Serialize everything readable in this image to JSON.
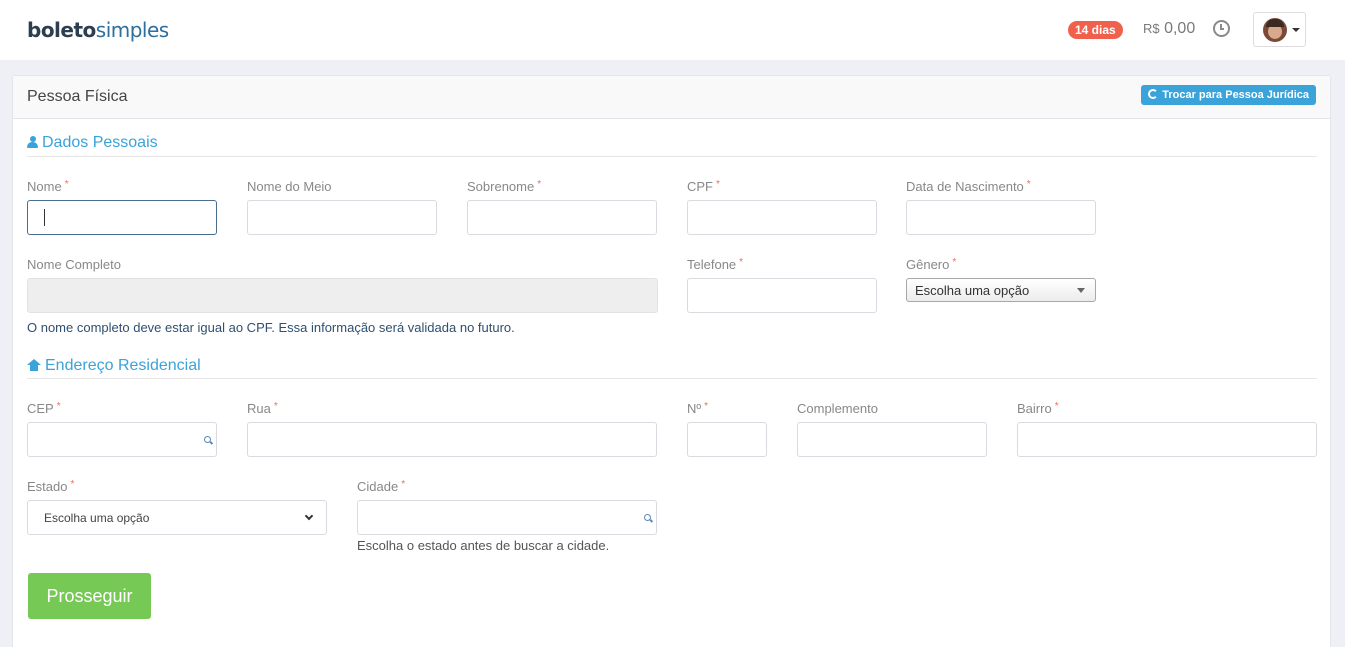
{
  "brand": {
    "part1": "boleto",
    "part2": "simples"
  },
  "header": {
    "trial_badge": "14 dias",
    "balance_currency": "R$",
    "balance_value": "0,00"
  },
  "panel": {
    "title": "Pessoa Física",
    "switch_button": "Trocar para Pessoa Jurídica"
  },
  "sections": {
    "personal": "Dados Pessoais",
    "address": "Endereço Residencial"
  },
  "fields": {
    "nome": "Nome",
    "nome_do_meio": "Nome do Meio",
    "sobrenome": "Sobrenome",
    "cpf": "CPF",
    "data_nascimento": "Data de Nascimento",
    "nome_completo": "Nome Completo",
    "telefone": "Telefone",
    "genero": "Gênero",
    "cep": "CEP",
    "rua": "Rua",
    "numero": "Nº",
    "complemento": "Complemento",
    "bairro": "Bairro",
    "estado": "Estado",
    "cidade": "Cidade"
  },
  "required_marker": "*",
  "selects": {
    "genero_value": "Escolha uma opção",
    "estado_value": "Escolha uma opção"
  },
  "help": {
    "nome_completo": "O nome completo deve estar igual ao CPF. Essa informação será validada no futuro.",
    "cidade": "Escolha o estado antes de buscar a cidade."
  },
  "submit_label": "Prosseguir"
}
